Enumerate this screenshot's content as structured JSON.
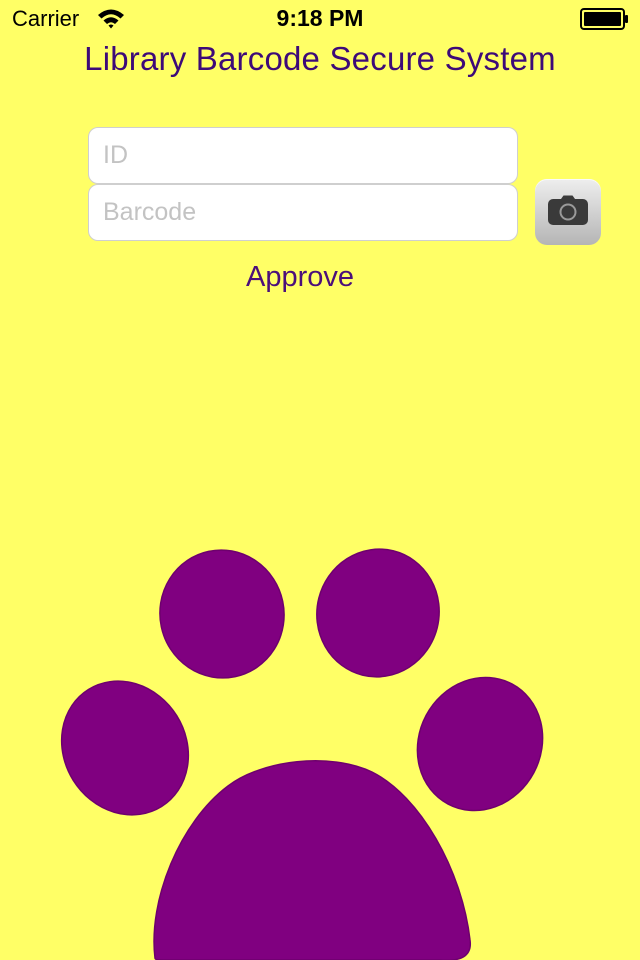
{
  "status_bar": {
    "carrier": "Carrier",
    "time": "9:18 PM",
    "icons": [
      "wifi-icon",
      "battery-icon"
    ]
  },
  "title": "Library Barcode Secure System",
  "form": {
    "id_placeholder": "ID",
    "id_value": "",
    "barcode_placeholder": "Barcode",
    "barcode_value": "",
    "camera_icon": "camera-icon",
    "approve_label": "Approve"
  },
  "logo": {
    "icon": "paw-print-icon",
    "color": "#800080"
  },
  "colors": {
    "background": "#ffff66",
    "title_text": "#3d0a78",
    "button_text": "#4b0f7a"
  }
}
